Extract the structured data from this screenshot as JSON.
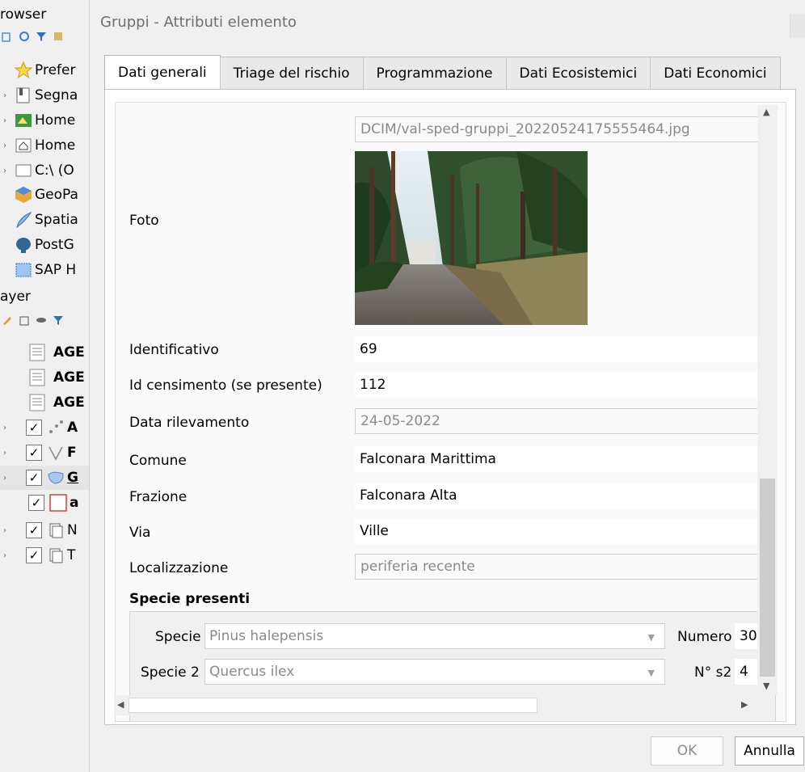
{
  "browser_panel": {
    "title": "rowser",
    "items": [
      {
        "label": "Prefer",
        "icon": "star-icon"
      },
      {
        "label": "Segna",
        "icon": "bookmark-icon"
      },
      {
        "label": "Home",
        "icon": "home-project-icon"
      },
      {
        "label": "Home",
        "icon": "home-folder-icon"
      },
      {
        "label": "C:\\ (O",
        "icon": "drive-icon"
      },
      {
        "label": "GeoPa",
        "icon": "geopackage-icon"
      },
      {
        "label": "Spatia",
        "icon": "spatialite-icon"
      },
      {
        "label": "PostG",
        "icon": "postgis-icon"
      },
      {
        "label": "SAP H",
        "icon": "sap-hana-icon"
      }
    ]
  },
  "layer_panel": {
    "title": "ayer",
    "items": [
      {
        "label": "AGE",
        "icon": "table-icon"
      },
      {
        "label": "AGE",
        "icon": "table-icon"
      },
      {
        "label": "AGE",
        "icon": "table-icon"
      },
      {
        "label": "A",
        "icon": "point-layer-icon"
      },
      {
        "label": "F",
        "icon": "line-layer-icon"
      },
      {
        "label": "G",
        "icon": "polygon-layer-icon"
      },
      {
        "label": "a",
        "icon": "empty-polygon-icon"
      },
      {
        "label": "N",
        "icon": "group-layer-icon"
      },
      {
        "label": "T",
        "icon": "group-layer-icon"
      }
    ]
  },
  "dialog": {
    "title": "Gruppi - Attributi elemento",
    "tabs": [
      "Dati generali",
      "Triage del rischio",
      "Programmazione",
      "Dati Ecosistemici",
      "Dati Economici"
    ],
    "active_tab": "Dati generali",
    "form": {
      "foto_label": "Foto",
      "foto_path": "DCIM/val-sped-gruppi_20220524175555464.jpg",
      "identificativo_label": "Identificativo",
      "identificativo": "69",
      "id_censimento_label": "Id censimento (se presente)",
      "id_censimento": "112",
      "data_label": "Data rilevamento",
      "data": "24-05-2022",
      "comune_label": "Comune",
      "comune": "Falconara Marittima",
      "frazione_label": "Frazione",
      "frazione": "Falconara Alta",
      "via_label": "Via",
      "via": "Ville",
      "localizzazione_label": "Localizzazione",
      "localizzazione": "periferia recente",
      "specie_group_label": "Specie presenti",
      "specie_label": "Specie",
      "specie": "Pinus halepensis",
      "numero_label": "Numero",
      "numero": "30",
      "specie2_label": "Specie 2",
      "specie2": "Quercus ilex",
      "n_s2_label": "N° s2",
      "n_s2": "4"
    },
    "buttons": {
      "ok": "OK",
      "cancel": "Annulla"
    }
  }
}
